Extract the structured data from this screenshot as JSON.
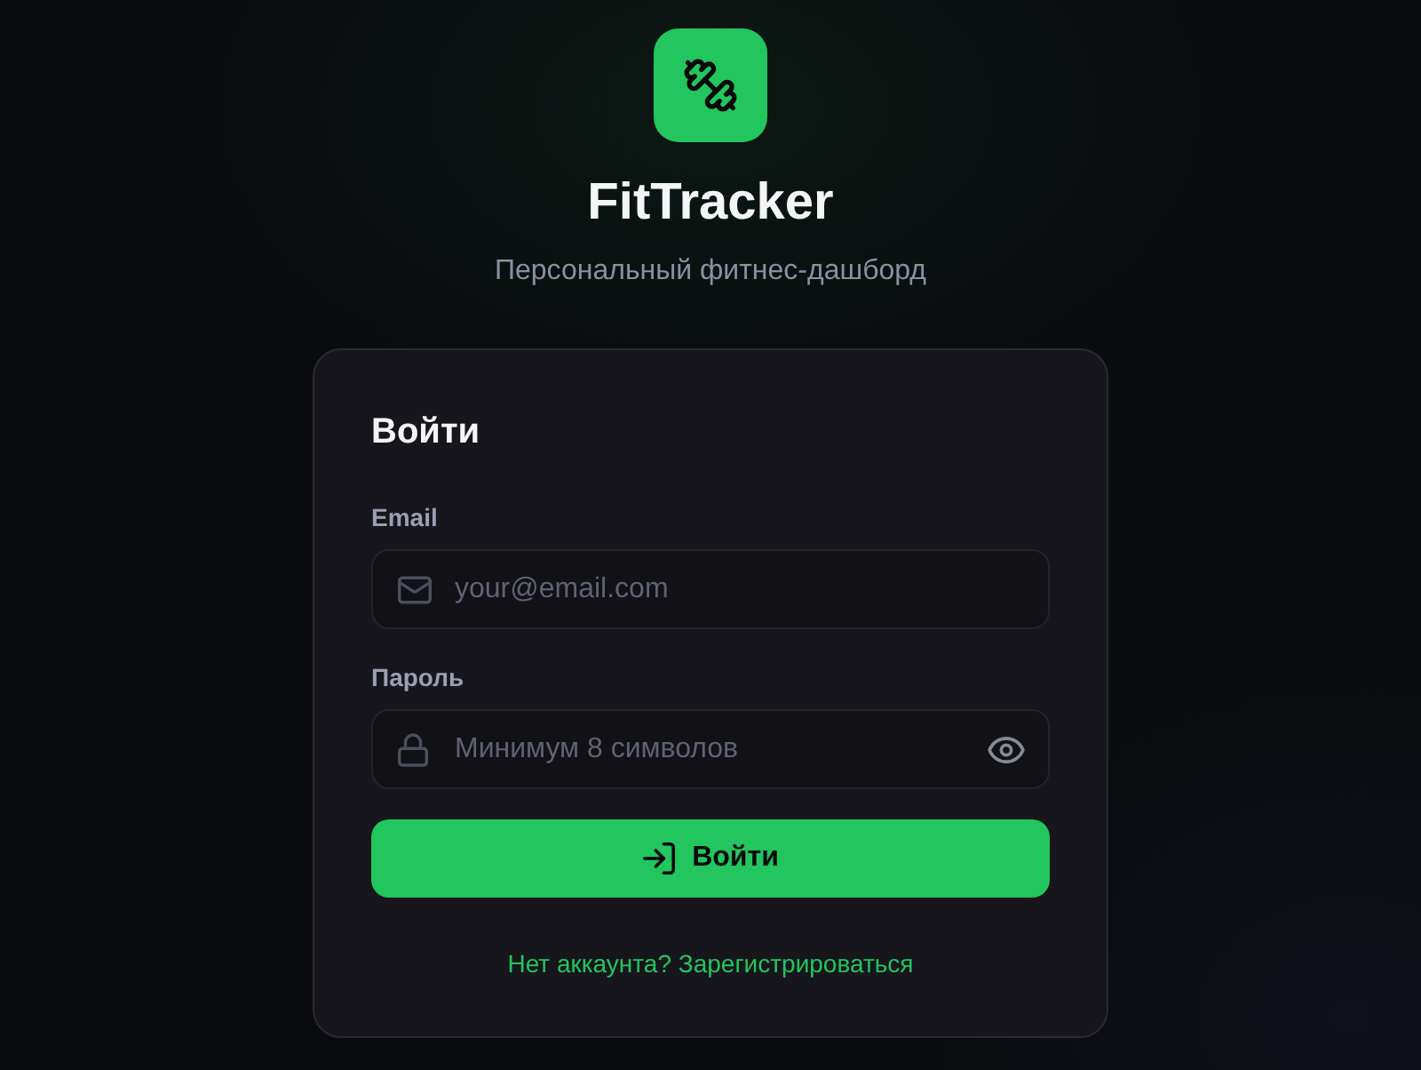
{
  "app": {
    "name": "FitTracker",
    "tagline": "Персональный фитнес-дашборд"
  },
  "login_form": {
    "title": "Войти",
    "fields": [
      {
        "kind": "email",
        "label": "Email",
        "placeholder": "your@email.com"
      },
      {
        "kind": "password",
        "label": "Пароль",
        "placeholder": "Минимум 8 символов"
      }
    ],
    "submit_button": "Войти",
    "register_link": "Нет аккаунта? Зарегистрироваться"
  }
}
